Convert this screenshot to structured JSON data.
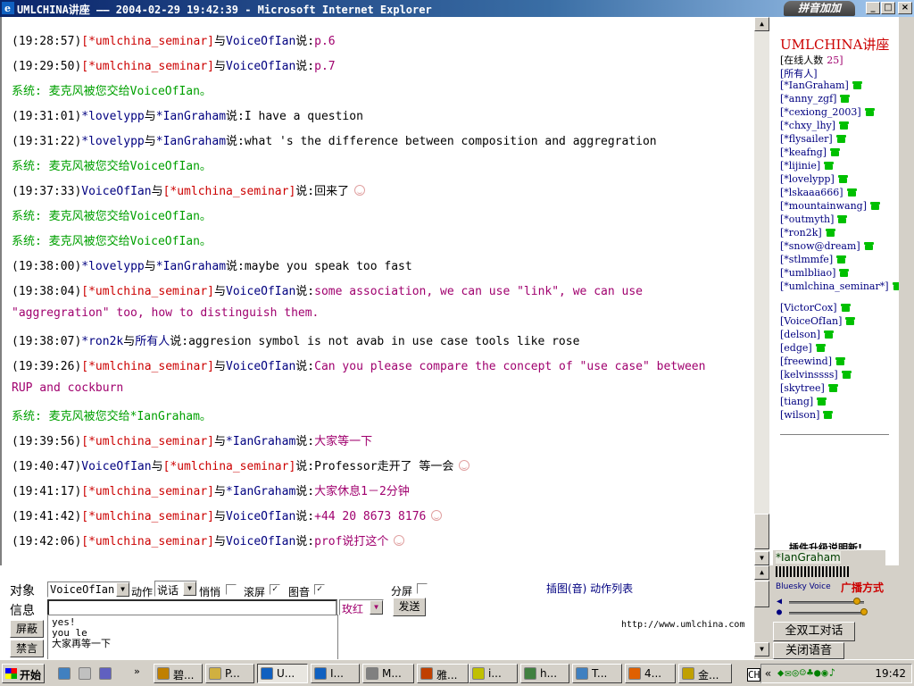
{
  "window": {
    "title": "UMLCHINA讲座 —— 2004-02-29 19:42:39 - Microsoft Internet Explorer",
    "ime_badge": "拼音加加",
    "btn_min": "_",
    "btn_max": "□",
    "btn_close": "×"
  },
  "chat": {
    "lines": [
      {
        "time": "(19:28:57)",
        "from": "[*umlchina_seminar]",
        "with": "与",
        "to": "VoiceOfIan",
        "say": "说:",
        "text": "p.6"
      },
      {
        "time": "(19:29:50)",
        "from": "[*umlchina_seminar]",
        "with": "与",
        "to": "VoiceOfIan",
        "say": "说:",
        "text": "p.7"
      },
      {
        "system": "系统:  麦克风被您交给VoiceOfIan。"
      },
      {
        "time": "(19:31:01)",
        "from": "*lovelypp",
        "with": "与",
        "to": "*IanGraham",
        "say": "说:",
        "text": "I have a question"
      },
      {
        "time": "(19:31:22)",
        "from": "*lovelypp",
        "with": "与",
        "to": "*IanGraham",
        "say": "说:",
        "text": "what 's the difference between composition and aggregration"
      },
      {
        "system": "系统:  麦克风被您交给VoiceOfIan。"
      },
      {
        "time": "(19:37:33)",
        "from": "VoiceOfIan",
        "with": "与",
        "to": "[*umlchina_seminar]",
        "say": "说:",
        "text": "回来了"
      },
      {
        "system": "系统:  麦克风被您交给VoiceOfIan。"
      },
      {
        "system": "系统:  麦克风被您交给VoiceOfIan。"
      },
      {
        "time": "(19:38:00)",
        "from": "*lovelypp",
        "with": "与",
        "to": "*IanGraham",
        "say": "说:",
        "text": "maybe you speak too fast"
      },
      {
        "time": "(19:38:04)",
        "from": "[*umlchina_seminar]",
        "with": "与",
        "to": "VoiceOfIan",
        "say": "说:",
        "text": "some association, we can use \"link\", we can use"
      },
      {
        "cont": "\"aggregration\" too, how to distinguish them."
      },
      {
        "time": "(19:38:07)",
        "from": "*ron2k",
        "with": "与",
        "to": "所有人",
        "say": "说:",
        "text": "aggresion symbol is not avab in use case tools like rose"
      },
      {
        "time": "(19:39:26)",
        "from": "[*umlchina_seminar]",
        "with": "与",
        "to": "VoiceOfIan",
        "say": "说:",
        "text": "Can you please compare the concept of \"use case\" between"
      },
      {
        "cont": "RUP and cockburn"
      },
      {
        "system": "系统:  麦克风被您交给*IanGraham。"
      },
      {
        "time": "(19:39:56)",
        "from": "[*umlchina_seminar]",
        "with": "与",
        "to": "*IanGraham",
        "say": "说:",
        "text": "大家等一下"
      },
      {
        "time": "(19:40:47)",
        "from": "VoiceOfIan",
        "with": "与",
        "to": "[*umlchina_seminar]",
        "say": "说:",
        "text": "Professor走开了 等一会"
      },
      {
        "time": "(19:41:17)",
        "from": "[*umlchina_seminar]",
        "with": "与",
        "to": "*IanGraham",
        "say": "说:",
        "text": "大家休息1－2分钟"
      },
      {
        "time": "(19:41:42)",
        "from": "[*umlchina_seminar]",
        "with": "与",
        "to": "VoiceOfIan",
        "say": "说:",
        "text": "+44 20 8673 8176"
      },
      {
        "time": "(19:42:06)",
        "from": "[*umlchina_seminar]",
        "with": "与",
        "to": "VoiceOfIan",
        "say": "说:",
        "text": "prof说打这个"
      }
    ]
  },
  "sidebar": {
    "title": "UMLCHINA讲座",
    "online_label": "[在线人数",
    "online_count": "25]",
    "all_label": "[所有人]",
    "users": [
      "[*IanGraham]",
      "[*anny_zgf]",
      "[*cexiong_2003]",
      "[*chxy_lhy]",
      "[*flysailer]",
      "[*keafng]",
      "[*lijinie]",
      "[*lovelypp]",
      "[*lskaaa666]",
      "[*mountainwang]",
      "[*outmyth]",
      "[*ron2k]",
      "[*snow@dream]",
      "[*stlmmfe]",
      "[*umlbliao]",
      "[*umlchina_seminar*]"
    ],
    "guests": [
      "[VictorCox]",
      "[VoiceOfIan]",
      "[delson]",
      "[edge]",
      "[freewind]",
      "[kelvinssss]",
      "[skytree]",
      "[tiang]",
      "[wilson]"
    ],
    "plugin_ad": "插件升级说明新!"
  },
  "input": {
    "target_label": "对象",
    "target_value": "VoiceOfIan",
    "action_label": "动作",
    "action_value": "说话",
    "whisper_label": "悄悄",
    "scroll_label": "滚屏",
    "image_label": "图音",
    "split_label": "分屏",
    "info_label": "信息",
    "color_value": "玫红",
    "send_label": "发送",
    "block_label": "屏蔽",
    "mute_label": "禁言",
    "insert_links": "插图(音) 动作列表",
    "url": "http://www.umlchina.com",
    "history": [
      "yes!",
      "you le",
      "大家再等一下"
    ]
  },
  "voice": {
    "user": "*IanGraham",
    "brand": "Bluesky Voice",
    "broadcast": "广播方式",
    "duplex": "全双工对话",
    "close": "关闭语音"
  },
  "taskbar": {
    "start": "开始",
    "tasks": [
      "碧...",
      "P...",
      "U...",
      "I...",
      "M...",
      "雅...",
      "i...",
      "h...",
      "T...",
      "4...",
      "金..."
    ],
    "time": "19:42",
    "lang": "CH"
  },
  "colors": {
    "red": "#cc0000",
    "navy": "#000080",
    "magenta": "#a0006e",
    "green": "#00a000"
  }
}
